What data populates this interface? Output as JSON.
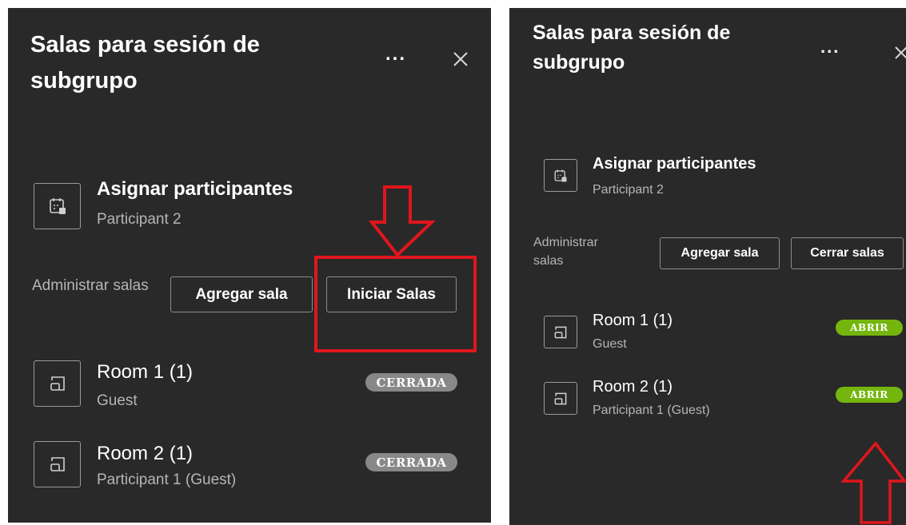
{
  "panels": [
    {
      "title": "Salas para sesión de subgrupo",
      "more_label": "...",
      "assign": {
        "title": "Asignar participantes",
        "subtitle": "Participant 2"
      },
      "manage_label": "Administrar salas",
      "buttons": {
        "add": "Agregar sala",
        "action": "Iniciar Salas"
      },
      "rooms": [
        {
          "name": "Room 1 (1)",
          "members": "Guest",
          "status": "CERRADA"
        },
        {
          "name": "Room 2 (1)",
          "members": "Participant 1 (Guest)",
          "status": "CERRADA"
        }
      ]
    },
    {
      "title": "Salas para sesión de subgrupo",
      "more_label": "...",
      "assign": {
        "title": "Asignar participantes",
        "subtitle": "Participant 2"
      },
      "manage_label": "Administrar salas",
      "buttons": {
        "add": "Agregar sala",
        "action": "Cerrar salas"
      },
      "rooms": [
        {
          "name": "Room 1 (1)",
          "members": "Guest",
          "status": "ABRIR"
        },
        {
          "name": "Room 2 (1)",
          "members": "Participant 1 (Guest)",
          "status": "ABRIR"
        }
      ]
    }
  ],
  "colors": {
    "panel_bg": "#292929",
    "badge_closed": "#888888",
    "badge_open": "#74b60d",
    "annotation_red": "#e0161c"
  }
}
